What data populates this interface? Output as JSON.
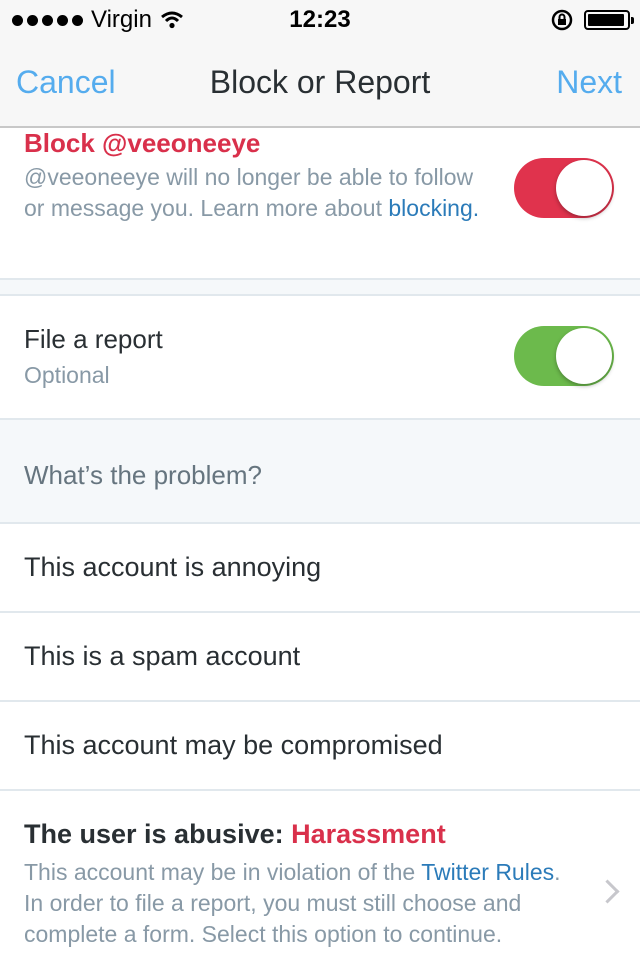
{
  "status_bar": {
    "carrier": "Virgin",
    "time": "12:23",
    "battery_level": 0.95
  },
  "nav": {
    "cancel_label": "Cancel",
    "title": "Block or Report",
    "next_label": "Next"
  },
  "block": {
    "title": "Block @veeoneeye",
    "desc_text": "@veeoneeye will no longer be able to follow or message you. Learn more about ",
    "desc_link": "blocking",
    "desc_end": ".",
    "toggle_on": true,
    "toggle_color": "#e0334d"
  },
  "report": {
    "title": "File a report",
    "subtitle": "Optional",
    "toggle_on": true,
    "toggle_color": "#6cba4c"
  },
  "problem": {
    "header": "What’s the problem?",
    "options": [
      {
        "label": "This account is annoying"
      },
      {
        "label": "This is a spam account"
      },
      {
        "label": "This account may be compromised"
      }
    ],
    "abusive": {
      "title_prefix": "The user is abusive: ",
      "title_tag": "Harassment",
      "desc_pre": "This account may be in violation of the ",
      "desc_link": "Twitter Rules",
      "desc_post": ". In order to file a report, you must still choose and complete a form. Select this option to continue."
    }
  },
  "colors": {
    "accent": "#55acee",
    "danger": "#d9304b",
    "link": "#2b7bb9"
  }
}
